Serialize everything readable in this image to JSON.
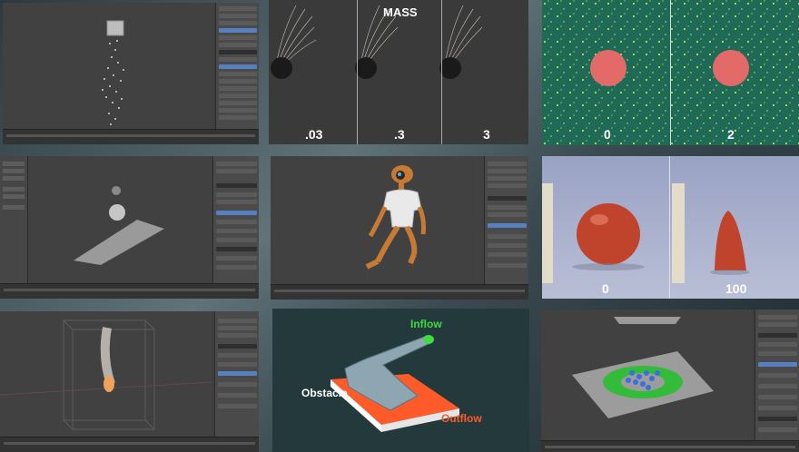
{
  "mass_panel": {
    "title": "MASS",
    "values": [
      ".03",
      ".3",
      "3"
    ]
  },
  "particles_panel": {
    "values": [
      "0",
      "2"
    ]
  },
  "softbody_panel": {
    "values": [
      "0",
      "100"
    ]
  },
  "fluid_panel": {
    "inflow_label": "Inflow",
    "obstacle_label": "Obstacle",
    "outflow_label": "Outflow",
    "colors": {
      "inflow": "#3fdc3f",
      "outflow": "#ff5a2a",
      "obstacle": "#ffffff"
    }
  }
}
